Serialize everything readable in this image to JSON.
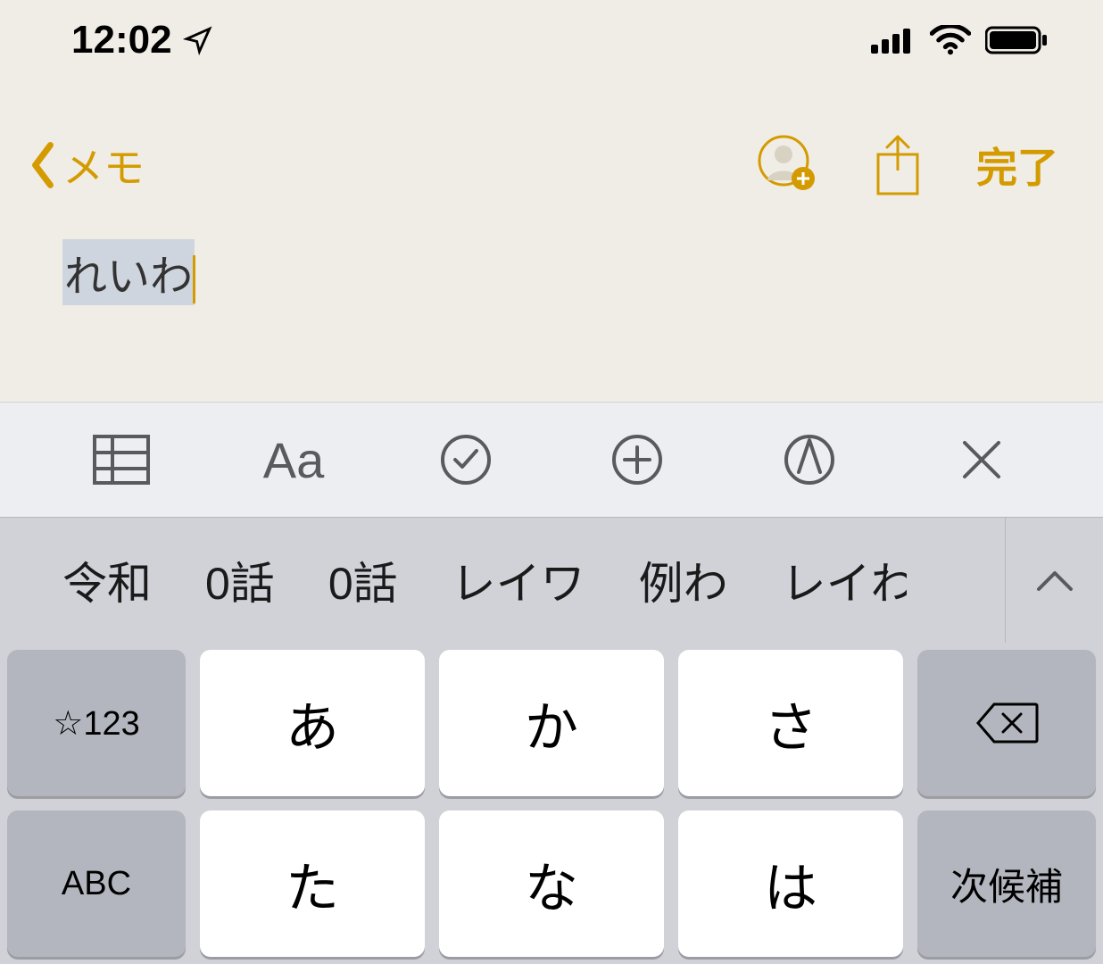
{
  "status": {
    "time": "12:02",
    "location_icon": "location-arrow",
    "signal": 4,
    "wifi": 3,
    "battery": 95
  },
  "nav": {
    "back_label": "メモ",
    "done_label": "完了"
  },
  "note": {
    "composing_text": "れいわ"
  },
  "accessory": {
    "text_format_label": "Aa"
  },
  "candidates": {
    "items": [
      "令和",
      "0話",
      "0話",
      "レイワ",
      "例わ",
      "レイわ"
    ]
  },
  "keyboard": {
    "sym_label": "☆123",
    "abc_label": "ABC",
    "next_candidate_label": "次候補",
    "rows": [
      [
        "あ",
        "か",
        "さ"
      ],
      [
        "た",
        "な",
        "は"
      ]
    ]
  }
}
